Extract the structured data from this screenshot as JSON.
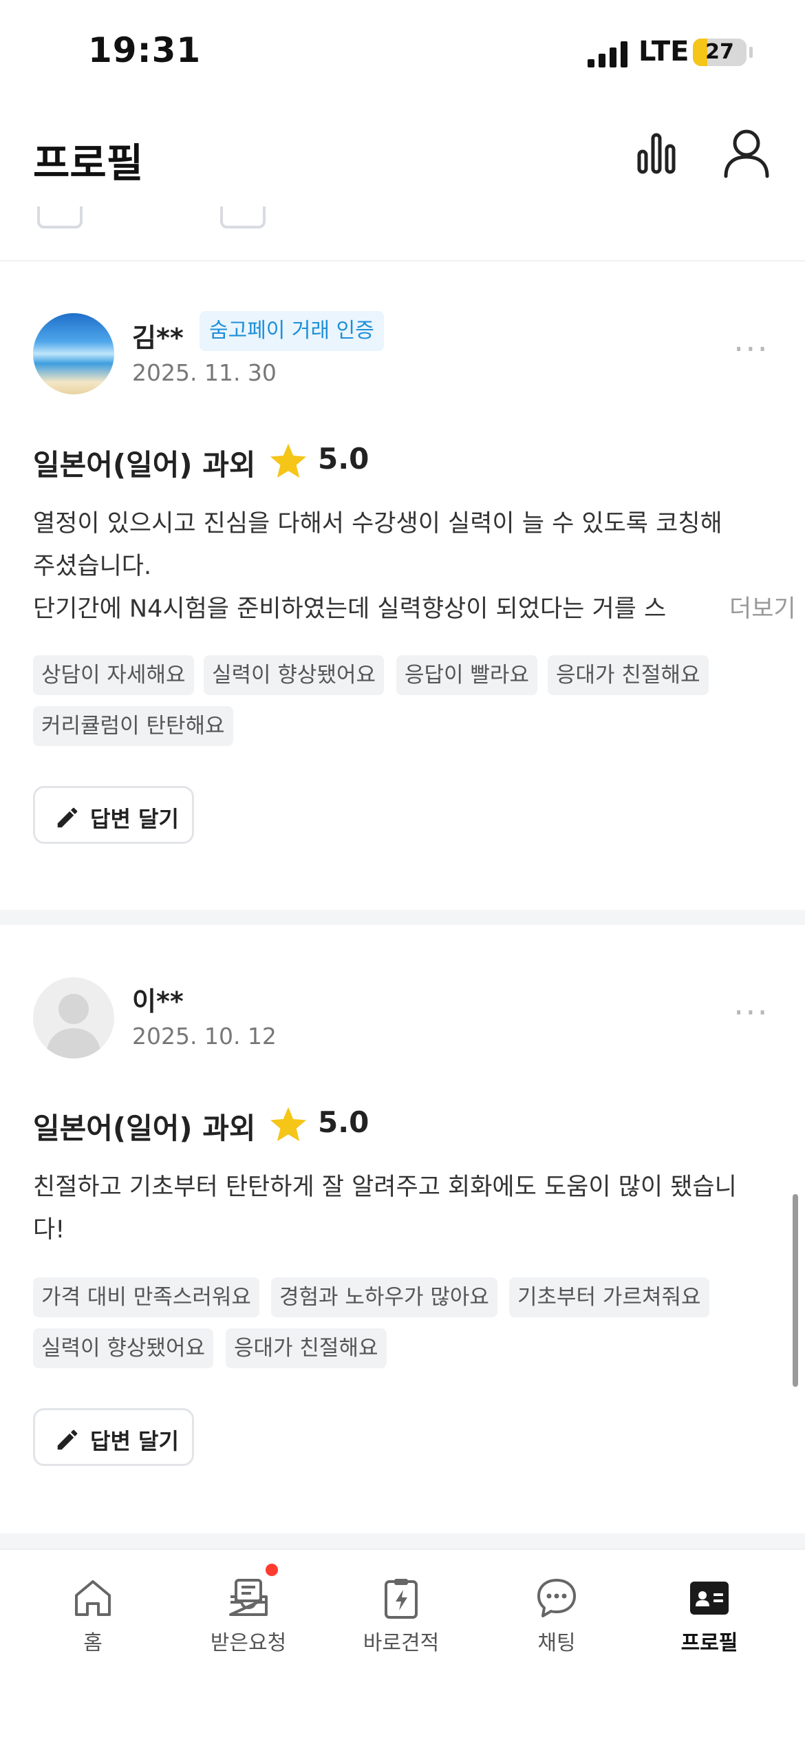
{
  "status_bar": {
    "time": "19:31",
    "network": "LTE",
    "battery": "27",
    "battery_level": 0.27
  },
  "header": {
    "title": "프로필"
  },
  "reviews": [
    {
      "name": "김**",
      "badge": "숨고페이 거래 인증",
      "date": "2025. 11. 30",
      "service": "일본어(일어) 과외",
      "rating": "5.0",
      "text_lines": [
        "열정이 있으시고 진심을 다해서 수강생이 실력이 늘 수 있도록 코칭해",
        "주셨습니다.",
        "단기간에 N4시험을 준비하였는데 실력향상이 되었다는 거를 스"
      ],
      "more_label": "더보기",
      "tags": [
        "상담이 자세해요",
        "실력이 향상됐어요",
        "응답이 빨라요",
        "응대가 친절해요",
        "커리큘럼이 탄탄해요"
      ],
      "reply_label": "답변 달기"
    },
    {
      "name": "이**",
      "date": "2025. 10. 12",
      "service": "일본어(일어) 과외",
      "rating": "5.0",
      "text_lines": [
        "친절하고 기초부터 탄탄하게 잘 알려주고 회화에도 도움이 많이 됐습니",
        "다!"
      ],
      "tags": [
        "가격 대비 만족스러워요",
        "경험과 노하우가 많아요",
        "기초부터 가르쳐줘요",
        "실력이 향상됐어요",
        "응대가 친절해요"
      ],
      "reply_label": "답변 달기"
    }
  ],
  "tabbar": {
    "items": [
      {
        "label": "홈",
        "icon": "home-icon"
      },
      {
        "label": "받은요청",
        "icon": "inbox-icon"
      },
      {
        "label": "바로견적",
        "icon": "quick-quote-icon"
      },
      {
        "label": "채팅",
        "icon": "chat-icon"
      },
      {
        "label": "프로필",
        "icon": "profile-card-icon"
      }
    ],
    "active": "프로필"
  },
  "colors": {
    "badge_text": "#1d8fd8",
    "badge_bg": "#eaf5fe",
    "star": "#f5c518",
    "notif": "#ff3b30"
  }
}
